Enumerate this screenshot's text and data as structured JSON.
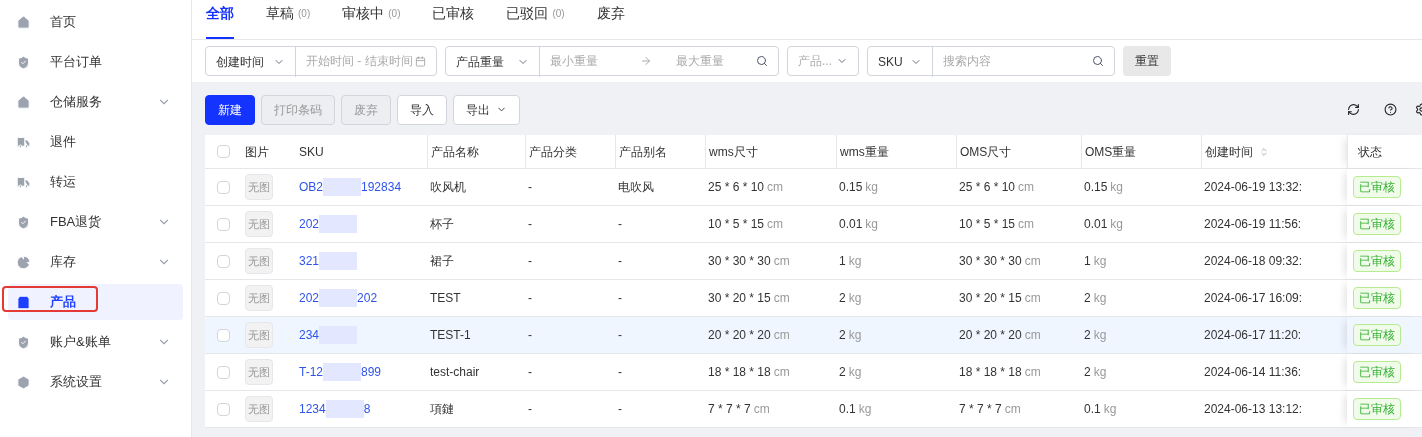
{
  "sidebar": {
    "items": [
      {
        "label": "首页",
        "kind": "home",
        "expandable": false,
        "selected": false,
        "highlighted": false
      },
      {
        "label": "平台订单",
        "kind": "shield",
        "expandable": false,
        "selected": false,
        "highlighted": false
      },
      {
        "label": "仓储服务",
        "kind": "home",
        "expandable": true,
        "selected": false,
        "highlighted": false
      },
      {
        "label": "退件",
        "kind": "truck",
        "expandable": false,
        "selected": false,
        "highlighted": false
      },
      {
        "label": "转运",
        "kind": "truck",
        "expandable": false,
        "selected": false,
        "highlighted": false
      },
      {
        "label": "FBA退货",
        "kind": "shield",
        "expandable": true,
        "selected": false,
        "highlighted": false
      },
      {
        "label": "库存",
        "kind": "pie",
        "expandable": true,
        "selected": false,
        "highlighted": false
      },
      {
        "label": "产品",
        "kind": "bag",
        "expandable": false,
        "selected": true,
        "highlighted": true
      },
      {
        "label": "账户&账单",
        "kind": "shield",
        "expandable": true,
        "selected": false,
        "highlighted": false
      },
      {
        "label": "系统设置",
        "kind": "hexagon",
        "expandable": true,
        "selected": false,
        "highlighted": false
      }
    ]
  },
  "tabs": [
    {
      "label": "全部",
      "selected": true
    },
    {
      "label": "草稿",
      "count": "(0)",
      "selected": false
    },
    {
      "label": "审核中",
      "count": "(0)",
      "selected": false
    },
    {
      "label": "已审核",
      "selected": false
    },
    {
      "label": "已驳回",
      "count": "(0)",
      "selected": false
    },
    {
      "label": "废弃",
      "selected": false
    }
  ],
  "filters": {
    "date": {
      "select": "创建时间",
      "placeholder": "开始时间 - 结束时间"
    },
    "weight": {
      "select": "产品重量",
      "min_placeholder": "最小重量",
      "max_placeholder": "最大重量"
    },
    "category": {
      "select": "产品..."
    },
    "search": {
      "select": "SKU",
      "placeholder": "搜索内容"
    },
    "reset": "重置"
  },
  "toolbar": [
    {
      "label": "新建",
      "kind": "primary",
      "disabled": false
    },
    {
      "label": "打印条码",
      "kind": "default",
      "disabled": true
    },
    {
      "label": "废弃",
      "kind": "default",
      "disabled": true
    },
    {
      "label": "导入",
      "kind": "default",
      "disabled": false
    },
    {
      "label": "导出",
      "kind": "dropdown",
      "disabled": false
    }
  ],
  "table": {
    "all_checked": false,
    "columns": [
      "图片",
      "SKU",
      "产品名称",
      "产品分类",
      "产品别名",
      "wms尺寸",
      "wms重量",
      "OMS尺寸",
      "OMS重量",
      "创建时间",
      "状态"
    ],
    "rows": [
      {
        "checked": false,
        "selected": false,
        "image": "无图",
        "sku": [
          "OB2",
          "192834"
        ],
        "name": "吹风机",
        "category": "-",
        "alias": "电吹风",
        "wms_size": {
          "value": "25 * 6 * 10",
          "unit": "cm"
        },
        "wms_weight": {
          "value": "0.15",
          "unit": "kg"
        },
        "oms_size": {
          "value": "25 * 6 * 10",
          "unit": "cm"
        },
        "oms_weight": {
          "value": "0.15",
          "unit": "kg"
        },
        "created": "2024-06-19 13:32:",
        "status": "已审核"
      },
      {
        "checked": false,
        "selected": false,
        "image": "无图",
        "sku": [
          "202"
        ],
        "name": "杯子",
        "category": "-",
        "alias": "-",
        "wms_size": {
          "value": "10 * 5 * 15",
          "unit": "cm"
        },
        "wms_weight": {
          "value": "0.01",
          "unit": "kg"
        },
        "oms_size": {
          "value": "10 * 5 * 15",
          "unit": "cm"
        },
        "oms_weight": {
          "value": "0.01",
          "unit": "kg"
        },
        "created": "2024-06-19 11:56:",
        "status": "已审核"
      },
      {
        "checked": false,
        "selected": false,
        "image": "无图",
        "sku": [
          "321"
        ],
        "name": "裙子",
        "category": "-",
        "alias": "-",
        "wms_size": {
          "value": "30 * 30 * 30",
          "unit": "cm"
        },
        "wms_weight": {
          "value": "1",
          "unit": "kg"
        },
        "oms_size": {
          "value": "30 * 30 * 30",
          "unit": "cm"
        },
        "oms_weight": {
          "value": "1",
          "unit": "kg"
        },
        "created": "2024-06-18 09:32:",
        "status": "已审核"
      },
      {
        "checked": false,
        "selected": false,
        "image": "无图",
        "sku": [
          "202",
          "202"
        ],
        "name": "TEST",
        "category": "-",
        "alias": "-",
        "wms_size": {
          "value": "30 * 20 * 15",
          "unit": "cm"
        },
        "wms_weight": {
          "value": "2",
          "unit": "kg"
        },
        "oms_size": {
          "value": "30 * 20 * 15",
          "unit": "cm"
        },
        "oms_weight": {
          "value": "2",
          "unit": "kg"
        },
        "created": "2024-06-17 16:09:",
        "status": "已审核"
      },
      {
        "checked": false,
        "selected": true,
        "image": "无图",
        "sku": [
          "234"
        ],
        "name": "TEST-1",
        "category": "-",
        "alias": "-",
        "wms_size": {
          "value": "20 * 20 * 20",
          "unit": "cm"
        },
        "wms_weight": {
          "value": "2",
          "unit": "kg"
        },
        "oms_size": {
          "value": "20 * 20 * 20",
          "unit": "cm"
        },
        "oms_weight": {
          "value": "2",
          "unit": "kg"
        },
        "created": "2024-06-17 11:20:",
        "status": "已审核"
      },
      {
        "checked": false,
        "selected": false,
        "image": "无图",
        "sku": [
          "T-12",
          "899"
        ],
        "name": "test-chair",
        "category": "-",
        "alias": "-",
        "wms_size": {
          "value": "18 * 18 * 18",
          "unit": "cm"
        },
        "wms_weight": {
          "value": "2",
          "unit": "kg"
        },
        "oms_size": {
          "value": "18 * 18 * 18",
          "unit": "cm"
        },
        "oms_weight": {
          "value": "2",
          "unit": "kg"
        },
        "created": "2024-06-14 11:36:",
        "status": "已审核"
      },
      {
        "checked": false,
        "selected": false,
        "image": "无图",
        "sku": [
          "1234",
          "8"
        ],
        "name": "項鏈",
        "category": "-",
        "alias": "-",
        "wms_size": {
          "value": "7 * 7 * 7",
          "unit": "cm"
        },
        "wms_weight": {
          "value": "0.1",
          "unit": "kg"
        },
        "oms_size": {
          "value": "7 * 7 * 7",
          "unit": "cm"
        },
        "oms_weight": {
          "value": "0.1",
          "unit": "kg"
        },
        "created": "2024-06-13 13:12:",
        "status": "已审核"
      }
    ]
  }
}
